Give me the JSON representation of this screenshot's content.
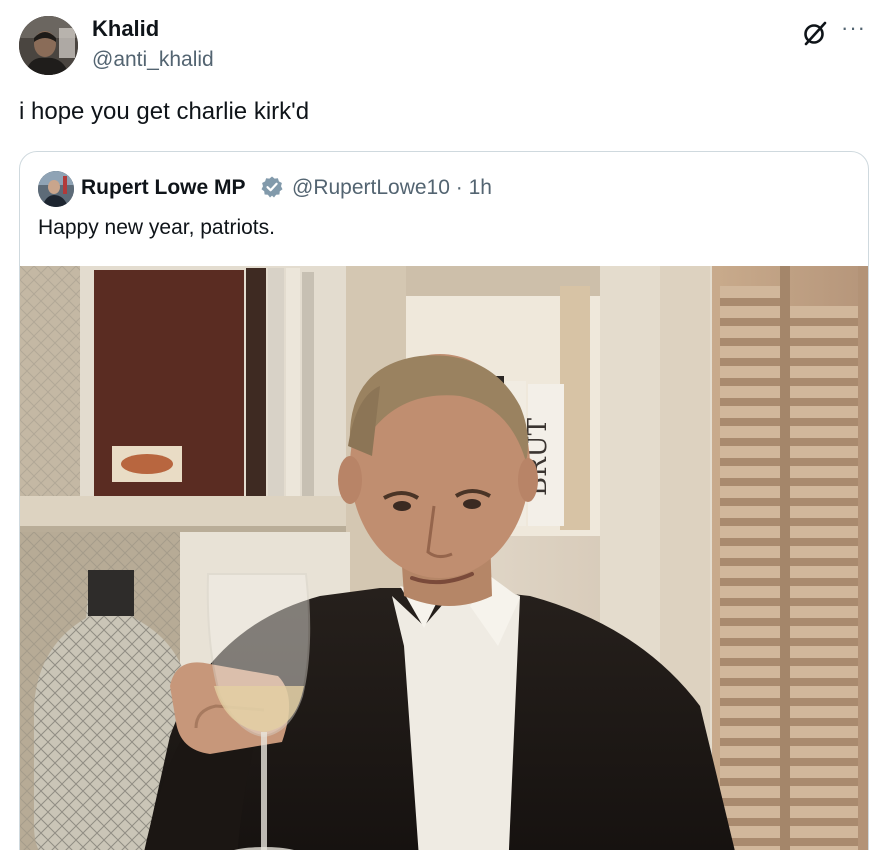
{
  "post": {
    "author_name": "Khalid",
    "author_handle": "@anti_khalid",
    "text": "i hope you get charlie kirk'd",
    "more_label": "···"
  },
  "quoted": {
    "author_name": "Rupert Lowe MP",
    "author_handle": "@RupertLowe10",
    "time": "· 1h",
    "text": "Happy new year, patriots.",
    "book_spine_text": "BRUT"
  },
  "colors": {
    "text_primary": "#0f1419",
    "text_secondary": "#536471",
    "border": "#cfd9de",
    "verified_badge": "#829aab"
  },
  "icons": {
    "grok": "grok-icon",
    "more": "more-icon",
    "verified": "verified-badge-icon"
  }
}
